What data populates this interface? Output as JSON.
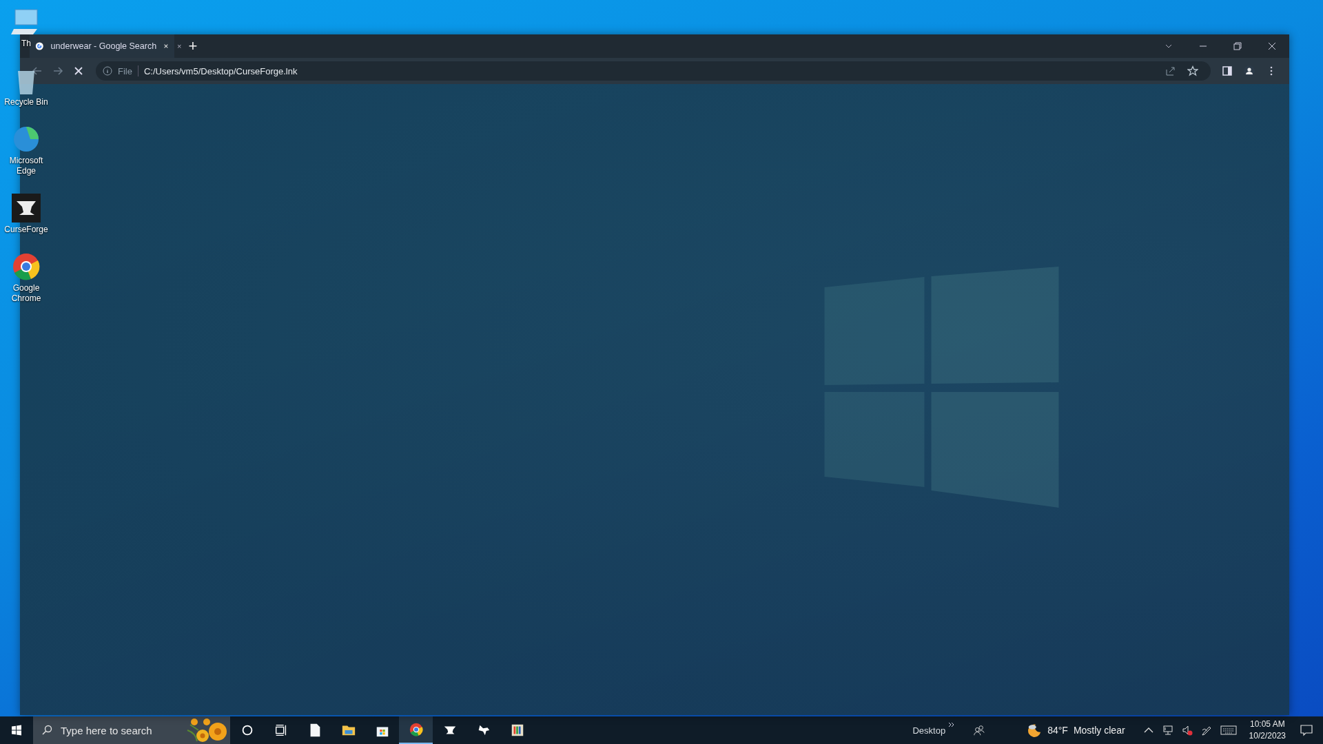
{
  "desktop_icons": [
    {
      "label": "Th",
      "kind": "pc"
    },
    {
      "label": "Recycle Bin",
      "kind": "bin"
    },
    {
      "label": "Microsoft Edge",
      "kind": "edge"
    },
    {
      "label": "CurseForge",
      "kind": "anvil"
    },
    {
      "label": "Google Chrome",
      "kind": "chrome"
    }
  ],
  "browser": {
    "tabs": [
      {
        "title": "underwear - Google Search",
        "selected": true
      }
    ],
    "tab_overflow_close": "×",
    "new_tab": "+",
    "address": {
      "scheme": "File",
      "url": "C:/Users/vm5/Desktop/CurseForge.lnk"
    }
  },
  "taskbar": {
    "search_placeholder": "Type here to search",
    "apps": [
      {
        "kind": "cortana",
        "active": false
      },
      {
        "kind": "taskview",
        "active": false
      },
      {
        "kind": "file",
        "active": false
      },
      {
        "kind": "folder",
        "active": false
      },
      {
        "kind": "store",
        "active": false
      },
      {
        "kind": "chrome",
        "active": true
      },
      {
        "kind": "anvil",
        "active": false
      },
      {
        "kind": "wolf",
        "active": false
      },
      {
        "kind": "paint",
        "active": false
      }
    ],
    "toolbar_label": "Desktop",
    "weather": {
      "temp": "84°F",
      "condition": "Mostly clear"
    },
    "time": "10:05 AM",
    "date": "10/2/2023"
  }
}
